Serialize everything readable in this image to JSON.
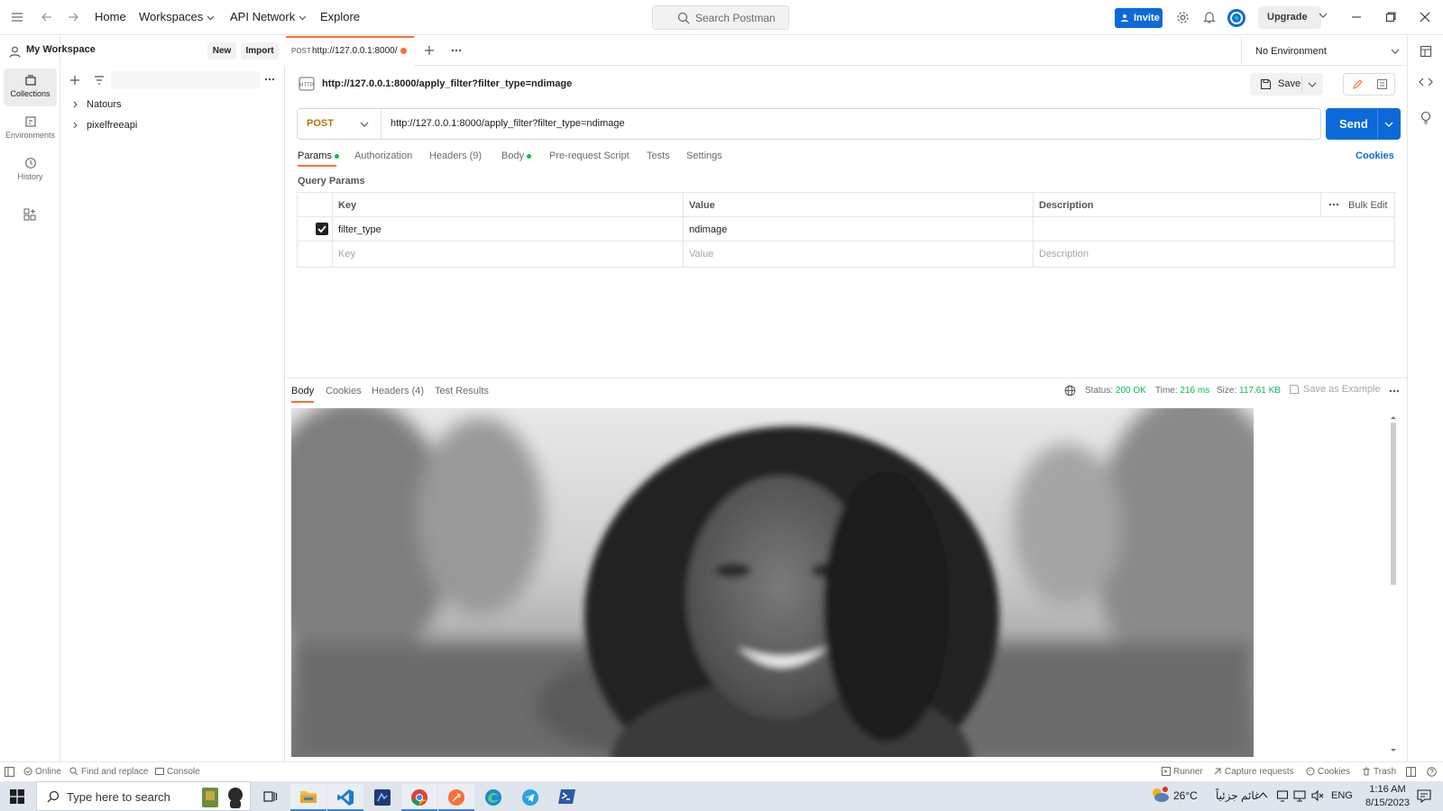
{
  "topbar": {
    "nav": {
      "home": "Home",
      "workspaces": "Workspaces",
      "api_network": "API Network",
      "explore": "Explore"
    },
    "search_placeholder": "Search Postman",
    "invite_label": "Invite",
    "upgrade_label": "Upgrade"
  },
  "sidebar": {
    "workspace_name": "My Workspace",
    "new_label": "New",
    "import_label": "Import",
    "rail": [
      {
        "label": "Collections",
        "icon": "collections-icon"
      },
      {
        "label": "Environments",
        "icon": "environments-icon"
      },
      {
        "label": "History",
        "icon": "history-icon"
      }
    ],
    "collections": [
      "Natours",
      "pixelfreeapi"
    ]
  },
  "tabs": [
    {
      "method": "POST",
      "title": "http://127.0.0.1:8000/",
      "unsaved": true
    }
  ],
  "environment": {
    "selected": "No Environment"
  },
  "request": {
    "name": "http://127.0.0.1:8000/apply_filter?filter_type=ndimage",
    "method": "POST",
    "url": "http://127.0.0.1:8000/apply_filter?filter_type=ndimage",
    "send_label": "Send",
    "save_label": "Save",
    "tabs": [
      "Params",
      "Authorization",
      "Headers (9)",
      "Body",
      "Pre-request Script",
      "Tests",
      "Settings"
    ],
    "cookies_link": "Cookies",
    "query_params_title": "Query Params",
    "params_headers": {
      "key": "Key",
      "value": "Value",
      "description": "Description",
      "bulk_edit": "Bulk Edit"
    },
    "params": [
      {
        "checked": true,
        "key": "filter_type",
        "value": "ndimage",
        "description": ""
      }
    ],
    "empty_row": {
      "key": "Key",
      "value": "Value",
      "description": "Description"
    }
  },
  "response": {
    "tabs": [
      "Body",
      "Cookies",
      "Headers (4)",
      "Test Results"
    ],
    "status_label": "Status:",
    "status_value": "200 OK",
    "time_label": "Time:",
    "time_value": "216 ms",
    "size_label": "Size:",
    "size_value": "117.61 KB",
    "save_example": "Save as Example"
  },
  "statusbar": {
    "online": "Online",
    "find_replace": "Find and replace",
    "console": "Console",
    "runner": "Runner",
    "capture": "Capture requests",
    "cookies": "Cookies",
    "trash": "Trash"
  },
  "taskbar": {
    "search_placeholder": "Type here to search",
    "weather": "26°C",
    "weather_text": "غائم جزئياً",
    "lang": "ENG",
    "time": "1:16 AM",
    "date": "8/15/2023"
  },
  "colors": {
    "accent": "#ff6c37",
    "primary_blue": "#0c6ad8",
    "status_ok": "#0cbb52"
  }
}
